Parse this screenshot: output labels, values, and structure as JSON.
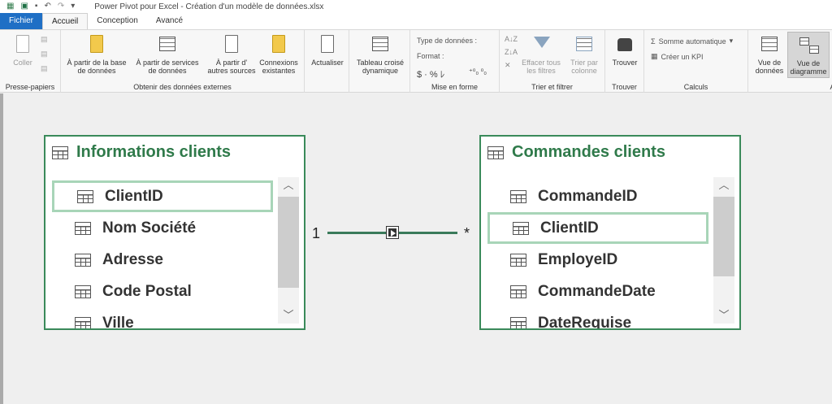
{
  "window": {
    "title": "Power Pivot pour Excel - Création d'un modèle de données.xlsx"
  },
  "tabs": [
    {
      "label": "Fichier"
    },
    {
      "label": "Accueil"
    },
    {
      "label": "Conception"
    },
    {
      "label": "Avancé"
    }
  ],
  "ribbon": {
    "clipboard": {
      "label": "Presse-papiers",
      "paste": "Coller"
    },
    "external": {
      "label": "Obtenir des données externes",
      "db_line1": "À partir de la base",
      "db_line2": "de données",
      "svc_line1": "À partir de services",
      "svc_line2": "de données",
      "other_line1": "À partir d'",
      "other_line2": "autres sources",
      "conn_line1": "Connexions",
      "conn_line2": "existantes"
    },
    "refresh": {
      "label": "Actualiser"
    },
    "pivot": {
      "line1": "Tableau croisé",
      "line2": "dynamique"
    },
    "format": {
      "label": "Mise en forme",
      "datatype": "Type de données :",
      "format": "Format :",
      "symbols": "$ · % ﾚ",
      "dec": "⁺⁰₀ ⁰₀"
    },
    "sort": {
      "label": "Trier et filtrer",
      "clear_line1": "Effacer tous",
      "clear_line2": "les filtres",
      "bycol_line1": "Trier par",
      "bycol_line2": "colonne"
    },
    "find": {
      "label": "Trouver",
      "button": "Trouver"
    },
    "calc": {
      "label": "Calculs",
      "autosum": "Somme automatique",
      "kpi": "Créer un KPI"
    },
    "view": {
      "data_line1": "Vue de",
      "data_line2": "données",
      "diagram_line1": "Vue de",
      "diagram_line2": "diagramme",
      "label_cut": "Af"
    }
  },
  "diagram": {
    "left_table": {
      "title": "Informations clients",
      "fields": [
        "ClientID",
        "Nom Société",
        "Adresse",
        "Code Postal",
        "Ville"
      ]
    },
    "right_table": {
      "title": "Commandes clients",
      "fields": [
        "CommandeID",
        "ClientID",
        "EmployeID",
        "CommandeDate",
        "DateRequise"
      ]
    },
    "relationship": {
      "left_cardinality": "1",
      "right_cardinality": "*"
    }
  },
  "colors": {
    "accent": "#2f7a4a",
    "highlight": "#a8d5b8",
    "file_tab": "#1f6fc5"
  }
}
